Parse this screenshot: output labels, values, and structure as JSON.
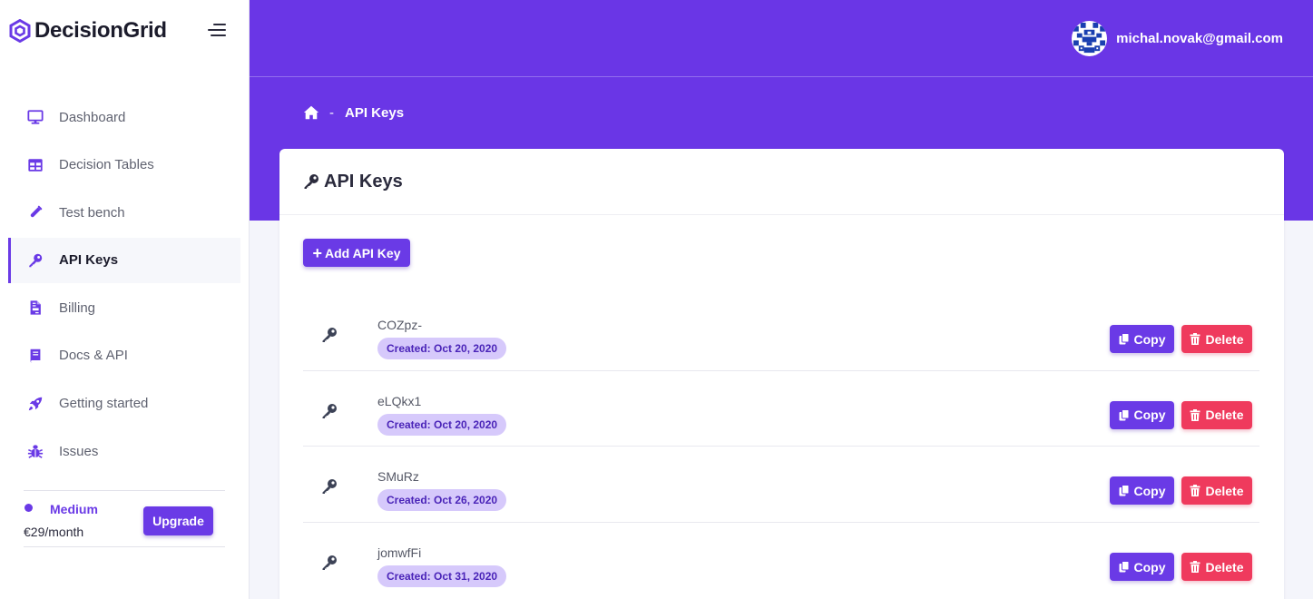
{
  "brand": {
    "name": "DecisionGrid",
    "icon": "hexagon-logo-icon"
  },
  "colors": {
    "primary": "#6a36e6",
    "danger": "#ef3a5d",
    "badge_bg": "#d6c9fb",
    "badge_text": "#4a24b8"
  },
  "sidebar": {
    "items": [
      {
        "label": "Dashboard",
        "icon": "monitor-icon",
        "active": false
      },
      {
        "label": "Decision Tables",
        "icon": "table-icon",
        "active": false
      },
      {
        "label": "Test bench",
        "icon": "test-tube-icon",
        "active": false
      },
      {
        "label": "API Keys",
        "icon": "key-icon",
        "active": true
      },
      {
        "label": "Billing",
        "icon": "invoice-icon",
        "active": false
      },
      {
        "label": "Docs & API",
        "icon": "book-icon",
        "active": false
      },
      {
        "label": "Getting started",
        "icon": "rocket-icon",
        "active": false
      },
      {
        "label": "Issues",
        "icon": "bug-icon",
        "active": false
      }
    ],
    "plan": {
      "name": "Medium",
      "price": "€29/month",
      "upgrade_label": "Upgrade"
    }
  },
  "header": {
    "user_email": "michal.novak@gmail.com"
  },
  "breadcrumb": {
    "separator": "-",
    "current": "API Keys"
  },
  "card": {
    "title": "API Keys",
    "add_label": "Add API Key",
    "copy_label": "Copy",
    "delete_label": "Delete"
  },
  "keys": [
    {
      "name": "COZpz-",
      "created": "Created: Oct 20, 2020"
    },
    {
      "name": "eLQkx1",
      "created": "Created: Oct 20, 2020"
    },
    {
      "name": "SMuRz",
      "created": "Created: Oct 26, 2020"
    },
    {
      "name": "jomwfFi",
      "created": "Created: Oct 31, 2020"
    }
  ]
}
